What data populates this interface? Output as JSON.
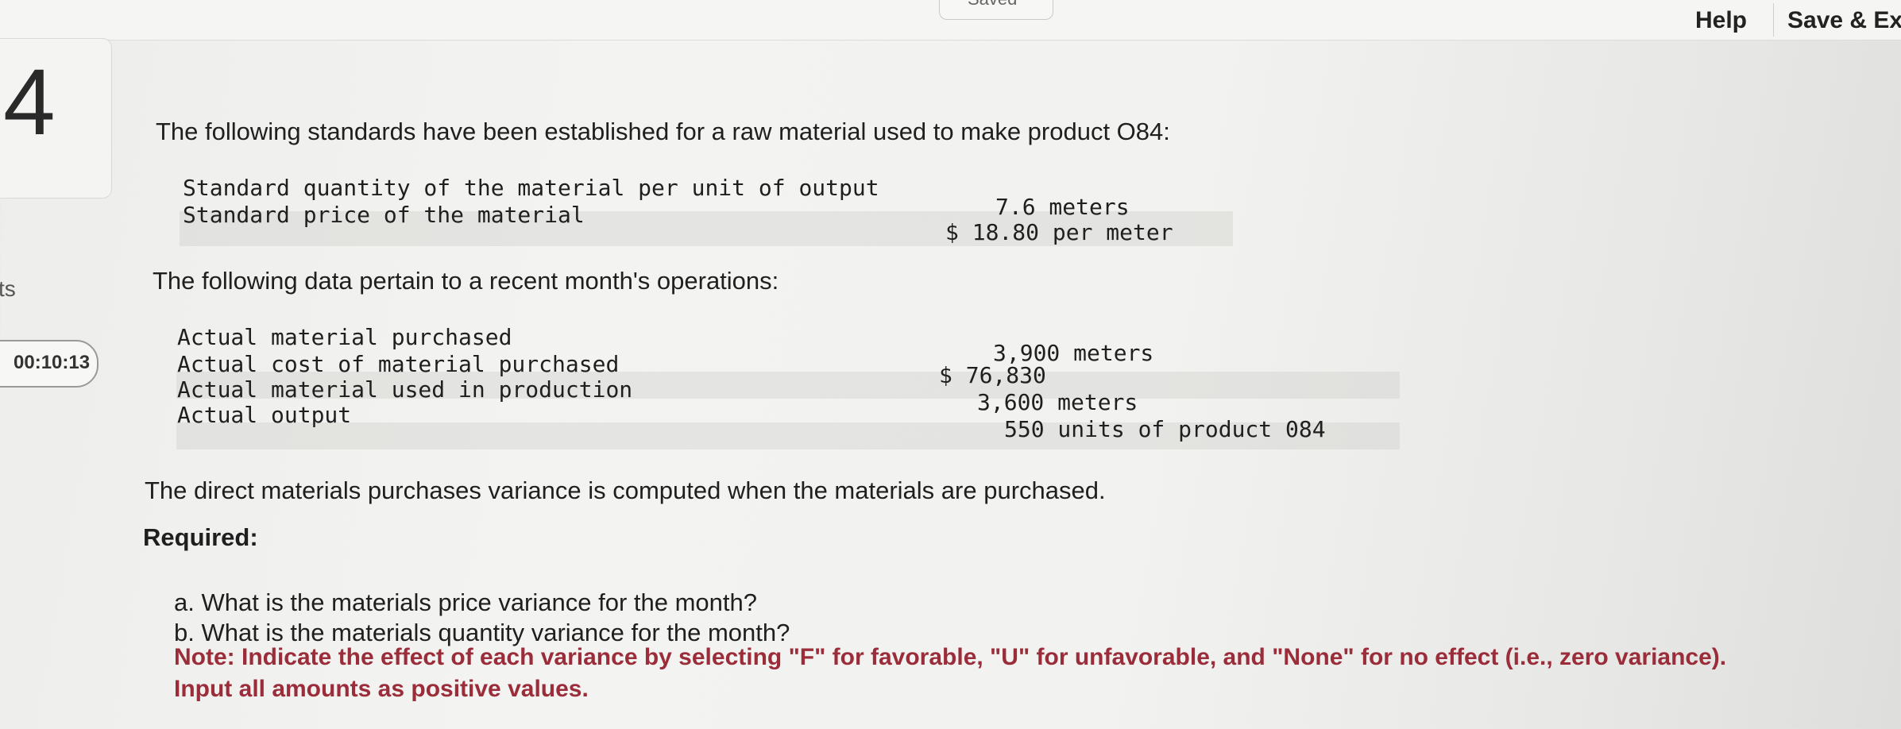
{
  "topbar": {
    "saved_label": "Saved",
    "help_label": "Help",
    "save_exit_label": "Save & Exit"
  },
  "sidebar": {
    "question_number": "4",
    "points_label": "ts",
    "timer": "00:10:13"
  },
  "question": {
    "intro": "The following standards have been established for a raw material used to make product O84:",
    "standards": [
      {
        "label": "Standard quantity of the material per unit of output",
        "value": "7.6 meters"
      },
      {
        "label": "Standard price of the material",
        "value": "$ 18.80 per meter"
      }
    ],
    "data_intro": "The following data pertain to a recent month's operations:",
    "actuals": [
      {
        "label": "Actual material purchased",
        "value": "3,900 meters"
      },
      {
        "label": "Actual cost of material purchased",
        "value": "$ 76,830"
      },
      {
        "label": "Actual material used in production",
        "value": "3,600 meters"
      },
      {
        "label": "Actual output",
        "value": "550 units of product 084"
      }
    ],
    "variance_note": "The direct materials purchases variance is computed when the materials are purchased.",
    "required_label": "Required:",
    "items": [
      "a. What is the materials price variance for the month?",
      "b. What is the materials quantity variance for the month?"
    ],
    "note": "Note: Indicate the effect of each variance by selecting \"F\" for favorable, \"U\" for unfavorable, and \"None\" for no effect (i.e., zero variance). Input all amounts as positive values."
  }
}
